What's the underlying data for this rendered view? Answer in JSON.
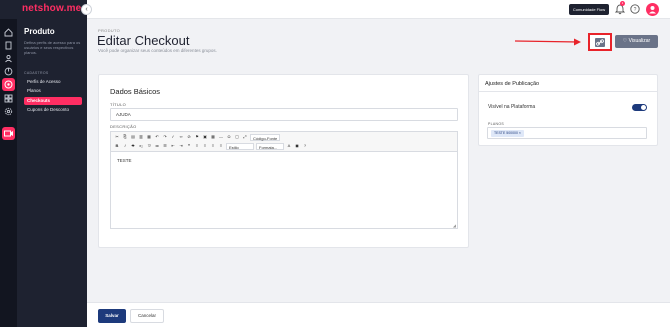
{
  "brand": {
    "logo": "netshow.me",
    "accent": "#ff2e63",
    "dark": "#1e2230",
    "primary": "#1d3a7c"
  },
  "topbar": {
    "community_button": "Comunidade Flow",
    "notification_count": "1"
  },
  "rail": {
    "icons": [
      "home-icon",
      "document-icon",
      "users-icon",
      "chart-icon",
      "product-icon",
      "grid-icon",
      "settings-icon",
      "video-icon"
    ]
  },
  "sidebar": {
    "title": "Produto",
    "description": "Defina perfis de acesso para os usuários e seus respectivos planos.",
    "section": "CADASTROS",
    "items": [
      {
        "label": "Perfis de Acesso"
      },
      {
        "label": "Planos"
      },
      {
        "label": "Checkouts"
      },
      {
        "label": "Cupons de Desconto"
      }
    ]
  },
  "header": {
    "breadcrumb": "PRODUTO",
    "title": "Editar Checkout",
    "subtitle": "Você pode organizar seus conteúdos em diferentes grupos.",
    "view_button": "Visualizar"
  },
  "basic": {
    "title": "Dados Básicos",
    "title_label": "TÍTULO",
    "title_value": "AJUDA",
    "description_label": "DESCRIÇÃO",
    "description_value": "TESTE",
    "toolbar": {
      "source": "Código-Fonte",
      "style": "Estilo",
      "format": "Formata..."
    }
  },
  "publish": {
    "title": "Ajustes de Publicação",
    "visible_label": "Visível na Plataforma",
    "plans_label": "PLANOS",
    "plan_tag": "TESTE 500000"
  },
  "footer": {
    "save": "Salvar",
    "cancel": "Cancelar"
  }
}
